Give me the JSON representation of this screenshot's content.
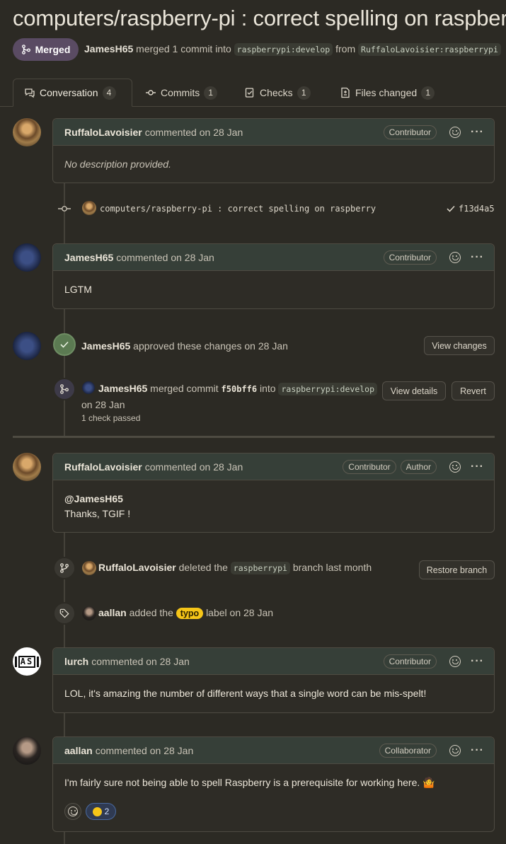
{
  "pr": {
    "title": "computers/raspberry-pi : correct spelling on raspberry",
    "state": "Merged",
    "meta": {
      "author": "JamesH65",
      "action": "merged 1 commit into",
      "base": "raspberrypi:develop",
      "from_word": "from",
      "head": "RuffaloLavoisier:raspberrypi"
    }
  },
  "tabs": [
    {
      "label": "Conversation",
      "count": "4"
    },
    {
      "label": "Commits",
      "count": "1"
    },
    {
      "label": "Checks",
      "count": "1"
    },
    {
      "label": "Files changed",
      "count": "1"
    }
  ],
  "comments": [
    {
      "author": "RuffaloLavoisier",
      "meta": "commented on 28 Jan",
      "role": "Contributor",
      "body": "No description provided."
    },
    {
      "author": "JamesH65",
      "meta": "commented on 28 Jan",
      "role": "Contributor",
      "body": "LGTM"
    },
    {
      "author": "RuffaloLavoisier",
      "meta": "commented on 28 Jan",
      "role": "Contributor",
      "role2": "Author",
      "body_line1": "@JamesH65",
      "body_line2": "Thanks, TGIF !"
    },
    {
      "author": "lurch",
      "meta": "commented on 28 Jan",
      "role": "Contributor",
      "body": "LOL, it's amazing the number of different ways that a single word can be mis-spelt!"
    },
    {
      "author": "aallan",
      "meta": "commented on 28 Jan",
      "role": "Collaborator",
      "body": "I'm fairly sure not being able to spell Raspberry is a prerequisite for working here. 🤷"
    }
  ],
  "commit": {
    "message": "computers/raspberry-pi : correct spelling on raspberry",
    "sha": "f13d4a5"
  },
  "approval": {
    "author": "JamesH65",
    "text": "approved these changes on 28 Jan",
    "button": "View changes"
  },
  "merge": {
    "author": "JamesH65",
    "text1": "merged commit",
    "sha": "f50bff6",
    "text2": "into",
    "base": "raspberrypi:develop",
    "date": "on 28 Jan",
    "checks": "1 check passed",
    "details_button": "View details",
    "revert_button": "Revert"
  },
  "branch_event": {
    "author": "RuffaloLavoisier",
    "text1": "deleted the",
    "branch": "raspberrypi",
    "text2": "branch last month",
    "button": "Restore branch"
  },
  "label_event": {
    "author": "aallan",
    "text1": "added the",
    "label": "typo",
    "text2": "label on 28 Jan"
  },
  "lurch_avatar_text": "AS",
  "reactions": {
    "count": "2"
  },
  "colors": {
    "merged": "#5a4b63",
    "label_typo": "#f5c518",
    "approve": "#5b7a52"
  },
  "icons": [
    "git-merge-icon",
    "conversation-icon",
    "commits-icon",
    "checks-icon",
    "files-icon",
    "smiley-icon",
    "kebab-icon",
    "check-icon",
    "tag-icon",
    "branch-icon"
  ]
}
